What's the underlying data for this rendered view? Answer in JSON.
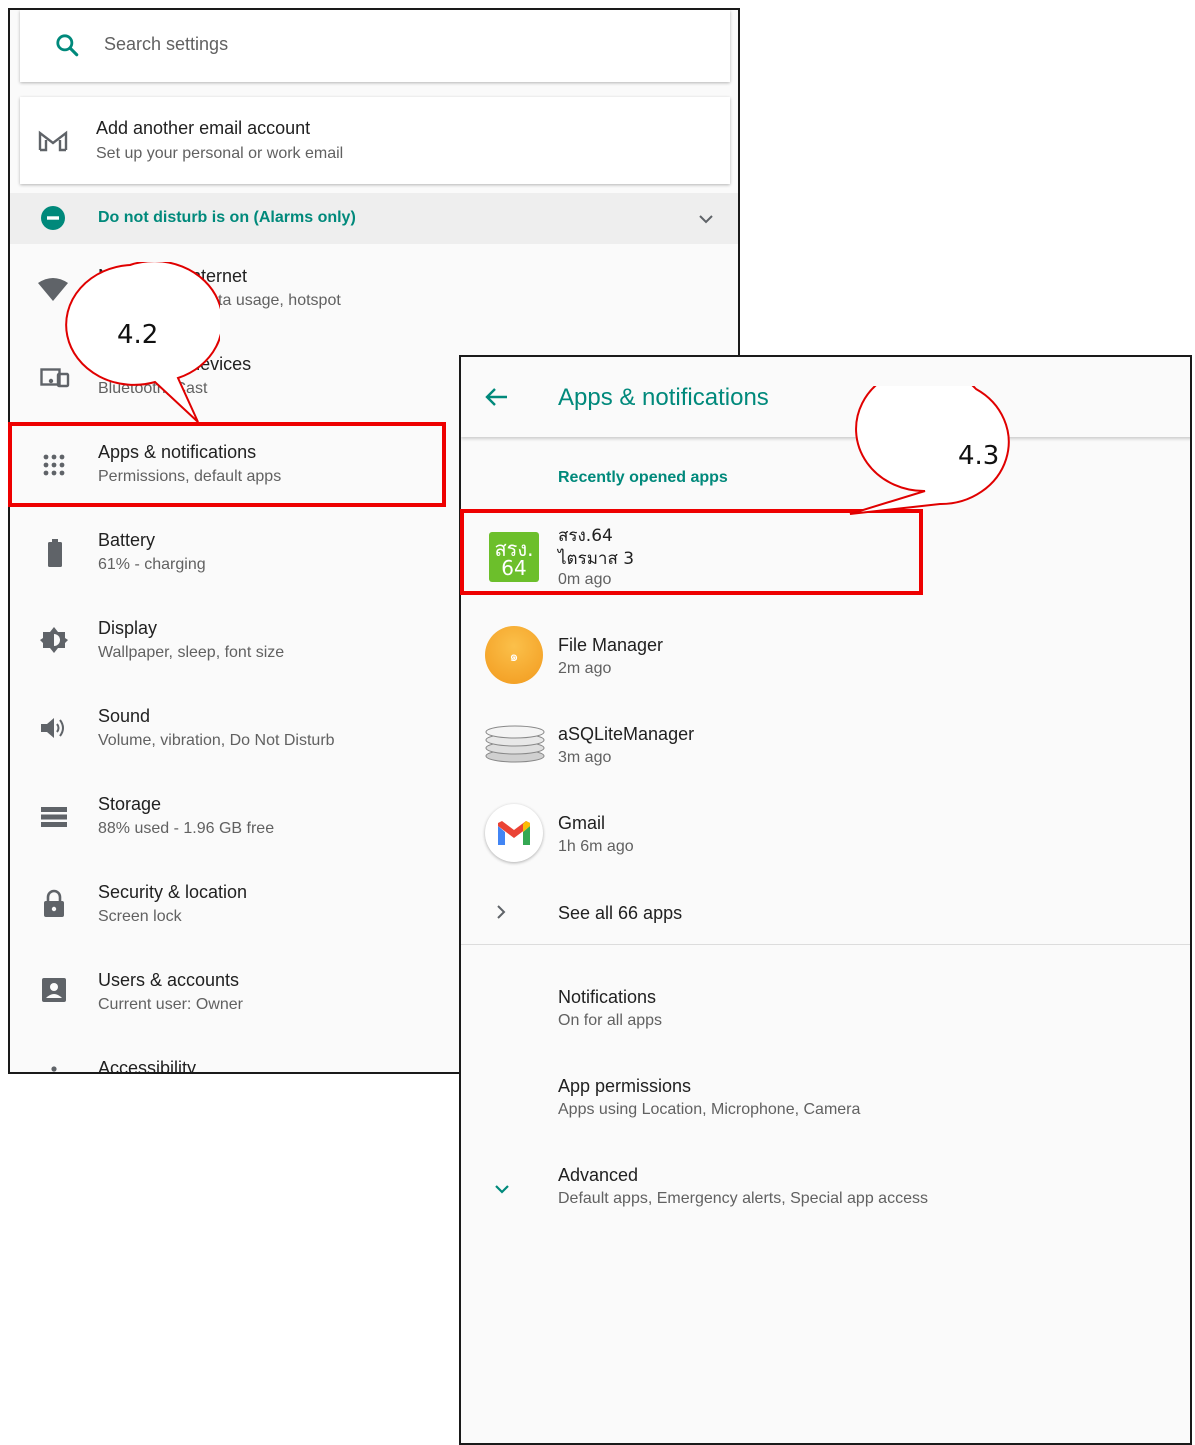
{
  "left_panel": {
    "search_placeholder": "Search settings",
    "suggestion": {
      "title": "Add another email account",
      "subtitle": "Set up your personal or work email"
    },
    "dnd_banner": "Do not disturb is on (Alarms only)",
    "items": [
      {
        "title": "Network & Internet",
        "subtitle": "Wi-Fi, mobile, data usage, hotspot",
        "icon": "wifi-icon"
      },
      {
        "title": "Connected devices",
        "subtitle": "Bluetooth, Cast",
        "icon": "devices-icon"
      },
      {
        "title": "Apps & notifications",
        "subtitle": "Permissions, default apps",
        "icon": "apps-grid-icon"
      },
      {
        "title": "Battery",
        "subtitle": "61% - charging",
        "icon": "battery-icon"
      },
      {
        "title": "Display",
        "subtitle": "Wallpaper, sleep, font size",
        "icon": "brightness-icon"
      },
      {
        "title": "Sound",
        "subtitle": "Volume, vibration, Do Not Disturb",
        "icon": "volume-icon"
      },
      {
        "title": "Storage",
        "subtitle": "88% used - 1.96 GB free",
        "icon": "storage-icon"
      },
      {
        "title": "Security & location",
        "subtitle": "Screen lock",
        "icon": "lock-icon"
      },
      {
        "title": "Users & accounts",
        "subtitle": "Current user: Owner",
        "icon": "account-icon"
      },
      {
        "title": "Accessibility",
        "subtitle": "",
        "icon": "accessibility-icon"
      }
    ]
  },
  "right_panel": {
    "title": "Apps & notifications",
    "section_header": "Recently opened apps",
    "recent_apps": [
      {
        "name": "สรง.64",
        "name2": "ไตรมาส 3",
        "time": "0m ago",
        "icon_text": "สรง.",
        "icon_text2": "64"
      },
      {
        "name": "File Manager",
        "time": "2m ago",
        "icon_text": "๑"
      },
      {
        "name": "aSQLiteManager",
        "time": "3m ago"
      },
      {
        "name": "Gmail",
        "time": "1h 6m ago"
      }
    ],
    "see_all": "See all 66 apps",
    "notifications": {
      "title": "Notifications",
      "subtitle": "On for all apps"
    },
    "permissions": {
      "title": "App permissions",
      "subtitle": "Apps using Location, Microphone, Camera"
    },
    "advanced": {
      "title": "Advanced",
      "subtitle": "Default apps, Emergency alerts, Special app access"
    }
  },
  "callouts": {
    "left": "4.2",
    "right": "4.3"
  },
  "colors": {
    "accent": "#00897b",
    "highlight": "#ee0000"
  }
}
